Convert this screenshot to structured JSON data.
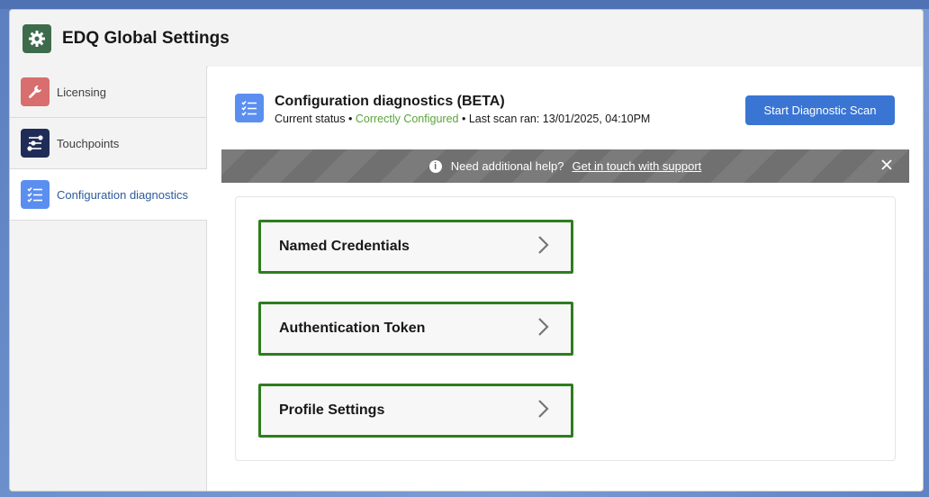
{
  "window": {
    "title": "EDQ Global Settings",
    "icon": "gear-icon"
  },
  "sidebar": {
    "items": [
      {
        "label": "Licensing",
        "icon": "wrench-icon",
        "color": "#d86e6e",
        "active": false
      },
      {
        "label": "Touchpoints",
        "icon": "route-icon",
        "color": "#1f2c57",
        "active": false
      },
      {
        "label": "Configuration diagnostics",
        "icon": "checklist-icon",
        "color": "#5a8ff0",
        "active": true
      }
    ]
  },
  "diagnostics": {
    "title": "Configuration diagnostics (BETA)",
    "status_prefix": "Current status",
    "separator": " • ",
    "status_value": "Correctly Configured",
    "last_scan": "Last scan ran: 13/01/2025, 04:10PM",
    "scan_button": "Start Diagnostic Scan",
    "status_color": "#5aa43a"
  },
  "help_bar": {
    "text": "Need additional help?",
    "link": "Get in touch with support"
  },
  "items": [
    {
      "label": "Named Credentials"
    },
    {
      "label": "Authentication Token"
    },
    {
      "label": "Profile Settings"
    }
  ],
  "colors": {
    "accent": "#3a75d4",
    "item_border": "#2e7d1e"
  }
}
